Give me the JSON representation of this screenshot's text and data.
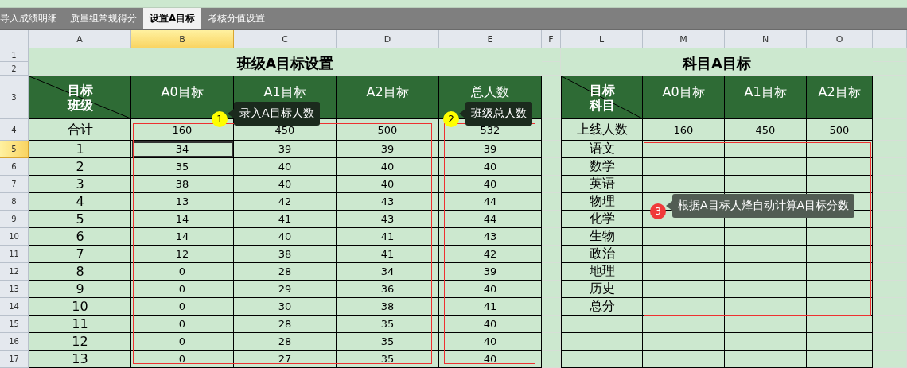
{
  "tabs": [
    {
      "label": "导入成绩明细",
      "selected": false
    },
    {
      "label": "质量组常规得分",
      "selected": false
    },
    {
      "label": "设置A目标",
      "selected": true
    },
    {
      "label": "考核分值设置",
      "selected": false
    }
  ],
  "column_headers": [
    {
      "label": "A",
      "selected": false
    },
    {
      "label": "B",
      "selected": true
    },
    {
      "label": "C",
      "selected": false
    },
    {
      "label": "D",
      "selected": false
    },
    {
      "label": "E",
      "selected": false
    },
    {
      "label": "F",
      "selected": false
    },
    {
      "label": "L",
      "selected": false
    },
    {
      "label": "M",
      "selected": false
    },
    {
      "label": "N",
      "selected": false
    },
    {
      "label": "O",
      "selected": false
    }
  ],
  "row_headers": [
    {
      "label": "1",
      "selected": false
    },
    {
      "label": "2",
      "selected": false
    },
    {
      "label": "3",
      "selected": false
    },
    {
      "label": "4",
      "selected": false
    },
    {
      "label": "5",
      "selected": true
    },
    {
      "label": "6",
      "selected": false
    },
    {
      "label": "7",
      "selected": false
    },
    {
      "label": "8",
      "selected": false
    },
    {
      "label": "9",
      "selected": false
    },
    {
      "label": "10",
      "selected": false
    },
    {
      "label": "11",
      "selected": false
    },
    {
      "label": "12",
      "selected": false
    },
    {
      "label": "13",
      "selected": false
    },
    {
      "label": "14",
      "selected": false
    },
    {
      "label": "15",
      "selected": false
    },
    {
      "label": "16",
      "selected": false
    },
    {
      "label": "17",
      "selected": false
    }
  ],
  "class_table": {
    "title": "班级A目标设置",
    "corner": {
      "top": "目标",
      "bottom": "班级"
    },
    "columns": [
      "A0目标",
      "A1目标",
      "A2目标",
      "总人数"
    ],
    "total_row": {
      "label": "合计",
      "values": [
        "160",
        "450",
        "500",
        "532"
      ]
    },
    "rows": [
      {
        "label": "1",
        "values": [
          "34",
          "39",
          "39",
          "39"
        ]
      },
      {
        "label": "2",
        "values": [
          "35",
          "40",
          "40",
          "40"
        ]
      },
      {
        "label": "3",
        "values": [
          "38",
          "40",
          "40",
          "40"
        ]
      },
      {
        "label": "4",
        "values": [
          "13",
          "42",
          "43",
          "44"
        ]
      },
      {
        "label": "5",
        "values": [
          "14",
          "41",
          "43",
          "44"
        ]
      },
      {
        "label": "6",
        "values": [
          "14",
          "40",
          "41",
          "43"
        ]
      },
      {
        "label": "7",
        "values": [
          "12",
          "38",
          "41",
          "42"
        ]
      },
      {
        "label": "8",
        "values": [
          "0",
          "28",
          "34",
          "39"
        ]
      },
      {
        "label": "9",
        "values": [
          "0",
          "29",
          "36",
          "40"
        ]
      },
      {
        "label": "10",
        "values": [
          "0",
          "30",
          "38",
          "41"
        ]
      },
      {
        "label": "11",
        "values": [
          "0",
          "28",
          "35",
          "40"
        ]
      },
      {
        "label": "12",
        "values": [
          "0",
          "28",
          "35",
          "40"
        ]
      },
      {
        "label": "13",
        "values": [
          "0",
          "27",
          "35",
          "40"
        ]
      }
    ]
  },
  "subject_table": {
    "title": "科目A目标",
    "corner": {
      "top": "目标",
      "bottom": "科目"
    },
    "columns": [
      "A0目标",
      "A1目标",
      "A2目标"
    ],
    "online_row": {
      "label": "上线人数",
      "values": [
        "160",
        "450",
        "500"
      ]
    },
    "rows": [
      {
        "label": "语文"
      },
      {
        "label": "数学"
      },
      {
        "label": "英语"
      },
      {
        "label": "物理"
      },
      {
        "label": "化学"
      },
      {
        "label": "生物"
      },
      {
        "label": "政治"
      },
      {
        "label": "地理"
      },
      {
        "label": "历史"
      },
      {
        "label": "总分"
      }
    ]
  },
  "callouts": [
    {
      "number": "1",
      "text": "录入A目标人数",
      "color": "#ffff00"
    },
    {
      "number": "2",
      "text": "班级总人数",
      "color": "#ffff00"
    },
    {
      "number": "3",
      "text": "根据A目标人烽自动计算A目标分数",
      "color": "#f03a3a"
    }
  ]
}
